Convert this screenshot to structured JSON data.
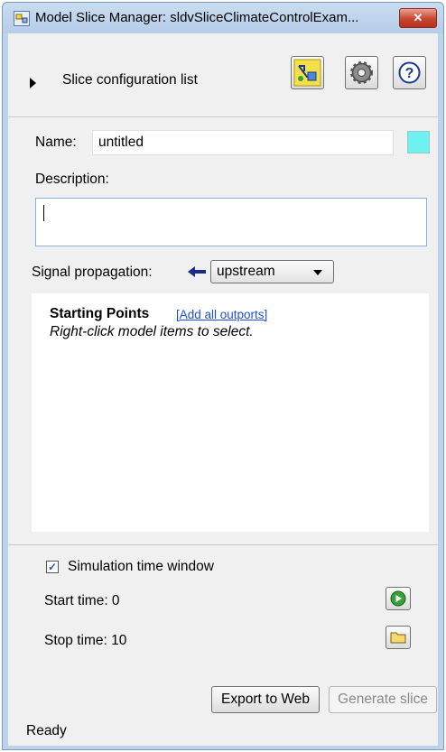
{
  "window": {
    "title": "Model Slice Manager: sldvSliceClimateControlExam...",
    "close_label": "✕"
  },
  "header": {
    "slice_list_label": "Slice configuration list",
    "buttons": [
      {
        "name": "highlight-slice-button",
        "icon": "model-highlight-icon"
      },
      {
        "name": "settings-button",
        "icon": "gear-icon"
      },
      {
        "name": "help-button",
        "icon": "help-icon"
      }
    ]
  },
  "form": {
    "name_label": "Name:",
    "name_value": "untitled",
    "slice_color": "#6ef1f1",
    "description_label": "Description:",
    "description_value": "",
    "signal_propagation_label": "Signal propagation:",
    "signal_propagation_value": "upstream",
    "signal_arrow_icon": "arrow-left-icon"
  },
  "starting_points": {
    "title": "Starting Points",
    "add_link": "[Add all outports]",
    "hint": "Right-click model items to select."
  },
  "simulation": {
    "checkbox_label": "Simulation time window",
    "checked": true,
    "start_label": "Start time: 0",
    "stop_label": "Stop time: 10",
    "run_icon": "play-icon",
    "folder_icon": "folder-icon"
  },
  "actions": {
    "export_label": "Export to Web",
    "generate_label": "Generate slice"
  },
  "status": "Ready",
  "colors": {
    "accent_link": "#1f4fd8",
    "arrow": "#1a2a8c",
    "window_frame": "#bcd3ec"
  }
}
